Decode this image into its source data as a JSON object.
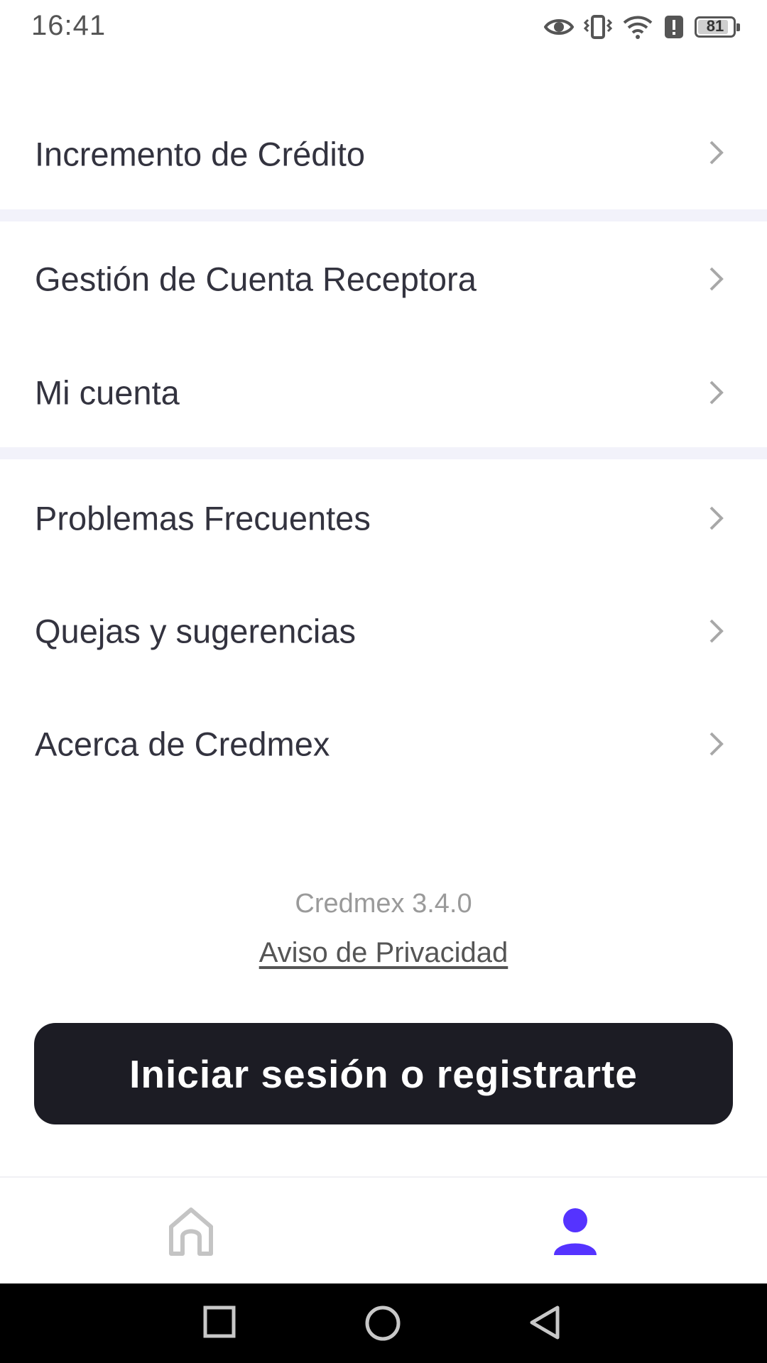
{
  "status_bar": {
    "time": "16:41",
    "battery_level": "81",
    "icons": [
      "eye-icon",
      "vibrate-icon",
      "wifi-icon",
      "alert-icon",
      "battery-icon"
    ]
  },
  "menu": {
    "items": [
      {
        "label": "Incremento de Crédito"
      },
      {
        "label": "Gestión de Cuenta Receptora"
      },
      {
        "label": "Mi cuenta"
      },
      {
        "label": "Problemas Frecuentes"
      },
      {
        "label": "Quejas y sugerencias"
      },
      {
        "label": "Acerca de Credmex"
      }
    ]
  },
  "footer": {
    "version": "Credmex 3.4.0",
    "privacy_link": "Aviso de Privacidad",
    "login_button": "Iniciar sesión o registrarte"
  },
  "bottom_nav": {
    "items": [
      "home-icon",
      "profile-icon"
    ],
    "active": "profile-icon",
    "active_color": "#5533ff",
    "inactive_color": "#c4c4c4"
  },
  "system_nav": {
    "buttons": [
      "recent-apps-icon",
      "home-circle-icon",
      "back-icon"
    ]
  }
}
